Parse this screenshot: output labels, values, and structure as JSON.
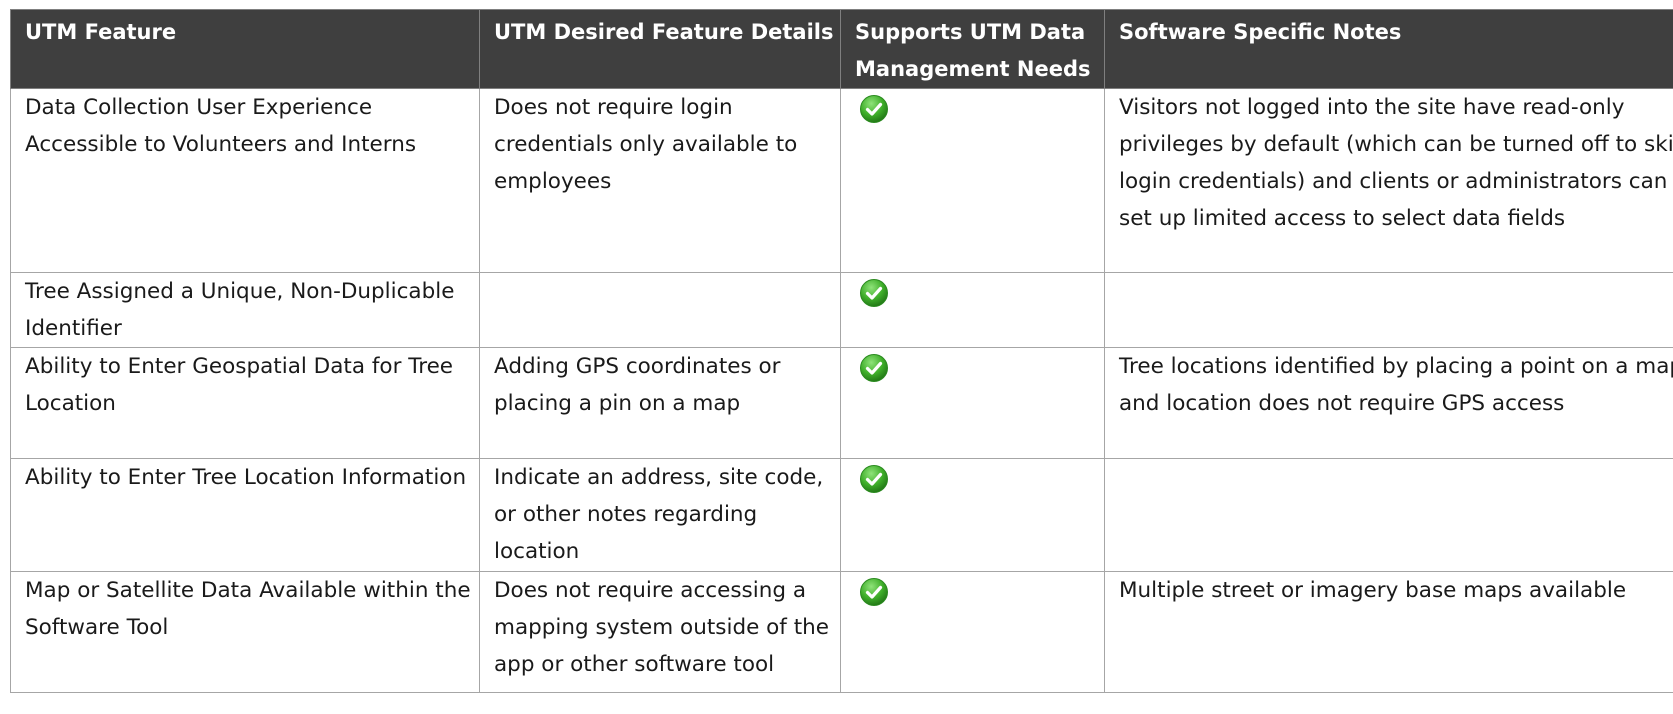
{
  "table": {
    "headers": [
      "UTM Feature",
      "UTM Desired Feature Details",
      "Supports UTM Data Management Needs",
      "Software Specific Notes"
    ],
    "rows": [
      {
        "feature": "Data Collection User Experience Accessible to Volunteers and Interns",
        "details": "Does not require login credentials only available to employees",
        "supports": "check-icon",
        "notes": "Visitors not logged into the site have read-only privileges by default (which can be turned off to skip login credentials) and clients or administrators can set up limited access to select data fields"
      },
      {
        "feature": "Tree Assigned a Unique, Non-Duplicable Identifier",
        "details": "",
        "supports": "check-icon",
        "notes": ""
      },
      {
        "feature": "Ability to Enter Geospatial Data for Tree Location",
        "details": "Adding GPS coordinates or placing a pin on a map",
        "supports": "check-icon",
        "notes": "Tree locations identified by placing a point on a map and location does not require GPS access"
      },
      {
        "feature": "Ability to Enter Tree Location Information",
        "details": "Indicate an address, site code, or other notes regarding location",
        "supports": "check-icon",
        "notes": ""
      },
      {
        "feature": "Map or Satellite Data Available within the Software Tool",
        "details": "Does not require accessing a mapping system outside of the app or other software tool",
        "supports": "check-icon",
        "notes": "Multiple street or imagery base maps available"
      }
    ]
  },
  "colors": {
    "header_bg": "#3f3f3f",
    "header_text": "#ffffff",
    "grid_line": "#a6a6a6",
    "check_green": "#3fae2a"
  }
}
